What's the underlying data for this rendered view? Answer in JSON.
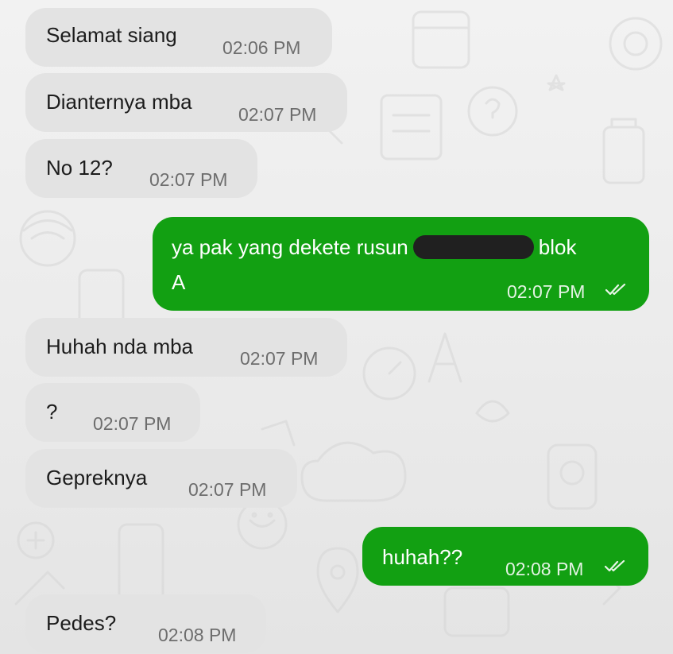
{
  "conversation": {
    "messages": [
      {
        "direction": "incoming",
        "text": "Selamat siang",
        "time": "02:06 PM"
      },
      {
        "direction": "incoming",
        "text": "Dianternya mba",
        "time": "02:07 PM"
      },
      {
        "direction": "incoming",
        "text": "No 12?",
        "time": "02:07 PM"
      },
      {
        "direction": "outgoing",
        "text_before": "ya pak yang dekete rusun",
        "text_after": "blok",
        "text_line2": "A",
        "redacted": true,
        "time": "02:07 PM",
        "status": "double-check-icon"
      },
      {
        "direction": "incoming",
        "text": "Huhah nda mba",
        "time": "02:07 PM"
      },
      {
        "direction": "incoming",
        "text": "?",
        "time": "02:07 PM"
      },
      {
        "direction": "incoming",
        "text": "Gepreknya",
        "time": "02:07 PM"
      },
      {
        "direction": "outgoing",
        "text": "huhah??",
        "time": "02:08 PM",
        "status": "double-check-icon"
      },
      {
        "direction": "incoming",
        "text": "Pedes?",
        "time": "02:08 PM"
      }
    ]
  },
  "colors": {
    "outgoing_bubble": "#12a012",
    "incoming_bubble": "#e3e3e3",
    "background": "#ececec"
  }
}
